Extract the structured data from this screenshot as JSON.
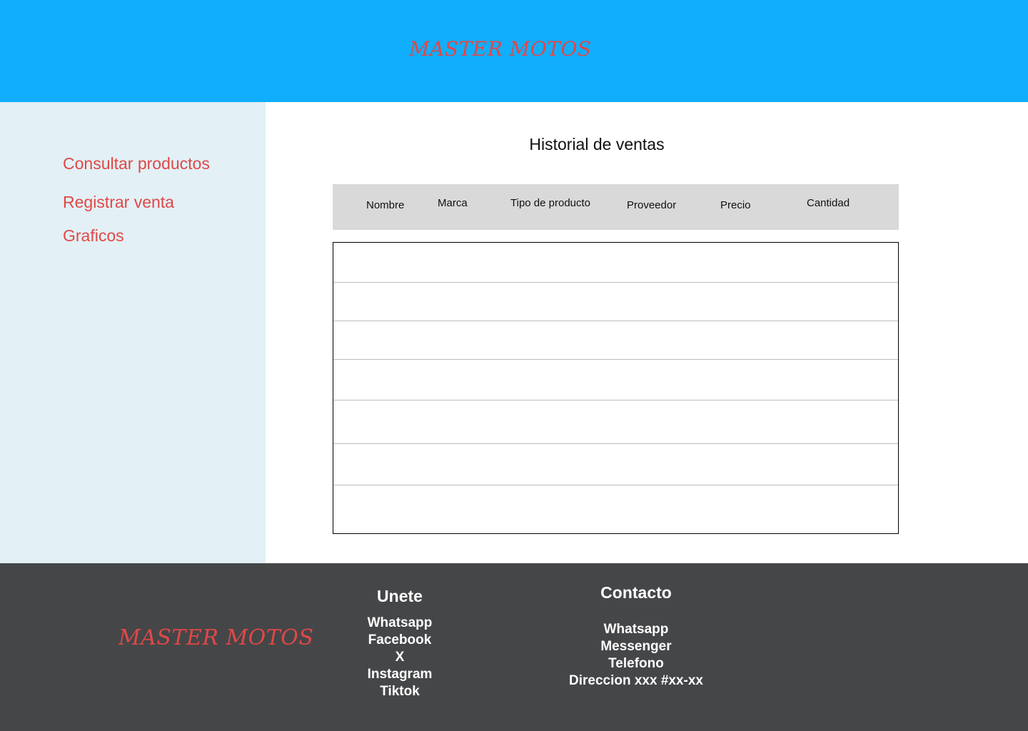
{
  "header": {
    "brand": "MASTER MOTOS"
  },
  "sidebar": {
    "items": [
      {
        "label": "Consultar productos"
      },
      {
        "label": "Registrar venta"
      },
      {
        "label": "Graficos"
      }
    ]
  },
  "main": {
    "title": "Historial de ventas",
    "table": {
      "columns": [
        "Nombre",
        "Marca",
        "Tipo de producto",
        "Proveedor",
        "Precio",
        "Cantidad"
      ],
      "rows": [
        [],
        [],
        [],
        [],
        [],
        [],
        []
      ]
    }
  },
  "footer": {
    "brand": "MASTER MOTOS",
    "join": {
      "title": "Unete",
      "links": [
        "Whatsapp",
        "Facebook",
        "X",
        "Instagram",
        "Tiktok"
      ]
    },
    "contact": {
      "title": "Contacto",
      "links": [
        "Whatsapp",
        "Messenger",
        "Telefono",
        "Direccion xxx #xx-xx"
      ]
    }
  },
  "colors": {
    "header_bg": "#10aefc",
    "sidebar_bg": "#e3f0f5",
    "accent_red": "#e04848",
    "footer_bg": "#454648",
    "table_header_bg": "#d9d9d9"
  }
}
